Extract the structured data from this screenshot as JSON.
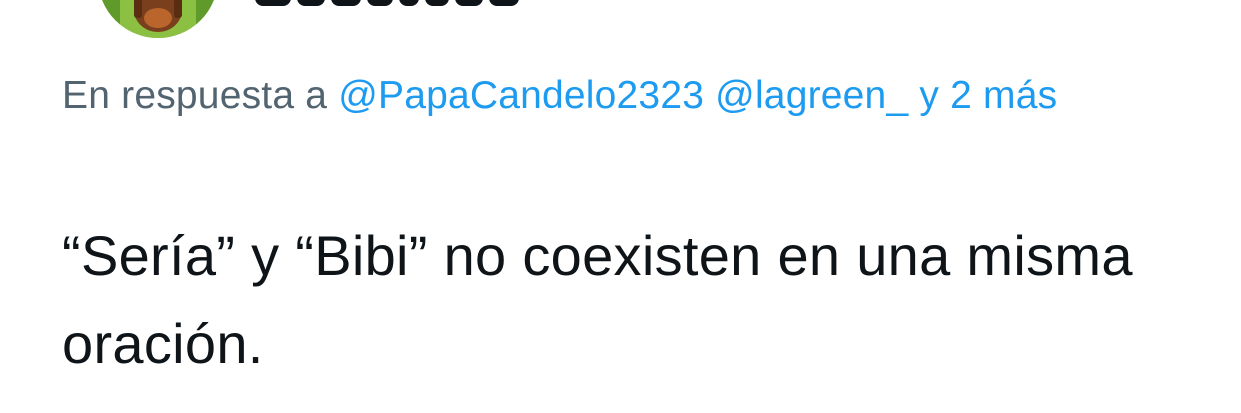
{
  "reply": {
    "prefix": "En respuesta a",
    "mention_1": "@PapaCandelo2323",
    "mention_2": "@lagreen_",
    "others": "y 2 más"
  },
  "tweet": {
    "text": "“Sería” y “Bibi” no coexisten en una misma oración."
  },
  "colors": {
    "link": "#1d9bf0",
    "secondary_text": "#536471",
    "primary_text": "#0f1419",
    "avatar_bg": "#7fb23c"
  }
}
